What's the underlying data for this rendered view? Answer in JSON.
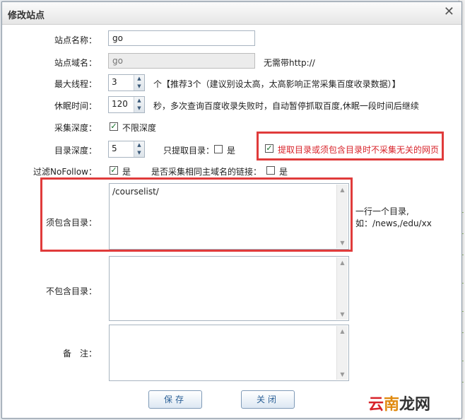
{
  "dialog": {
    "title": "修改站点",
    "close_glyph": "✕"
  },
  "form": {
    "site_name": {
      "label": "站点名称：",
      "value": "go"
    },
    "site_domain": {
      "label": "站点域名：",
      "placeholder": "go",
      "hint": "无需带http://"
    },
    "max_threads": {
      "label": "最大线程：",
      "value": "3",
      "hint": "个【推荐3个（建议别设太高，太高影响正常采集百度收录数据）】"
    },
    "sleep_time": {
      "label": "休眠时间：",
      "value": "120",
      "hint": "秒，多次查询百度收录失败时，自动暂停抓取百度,休眠一段时间后继续"
    },
    "crawl_depth": {
      "label": "采集深度：",
      "checkbox_label": "不限深度",
      "checked": true
    },
    "dir_depth": {
      "label": "目录深度：",
      "value": "5"
    },
    "only_dirs": {
      "label": "只提取目录：",
      "checkbox_label": "是",
      "checked": false
    },
    "exclude_unrelated": {
      "label": "提取目录或须包含目录时不采集无关的网页",
      "checked": true
    },
    "filter_nofollow": {
      "label": "过滤NoFollow：",
      "checkbox_label": "是",
      "checked": true
    },
    "same_domain": {
      "label": "是否采集相同主域名的链接：",
      "checkbox_label": "是",
      "checked": false
    },
    "must_include": {
      "label": "须包含目录：",
      "value": "/courselist/",
      "hint_line1": "一行一个目录,",
      "hint_line2": "如：/news,/edu/xx"
    },
    "not_include": {
      "label": "不包含目录：",
      "value": ""
    },
    "remark": {
      "label": "备　注：",
      "value": ""
    }
  },
  "buttons": {
    "save": "保存",
    "close": "关闭"
  },
  "watermark": {
    "part1": "云",
    "part2": "南",
    "part3": "龙网"
  },
  "colors": {
    "highlight_red": "#e03b3b",
    "button_text": "#2a5f96",
    "check_green": "#0a6b22"
  }
}
